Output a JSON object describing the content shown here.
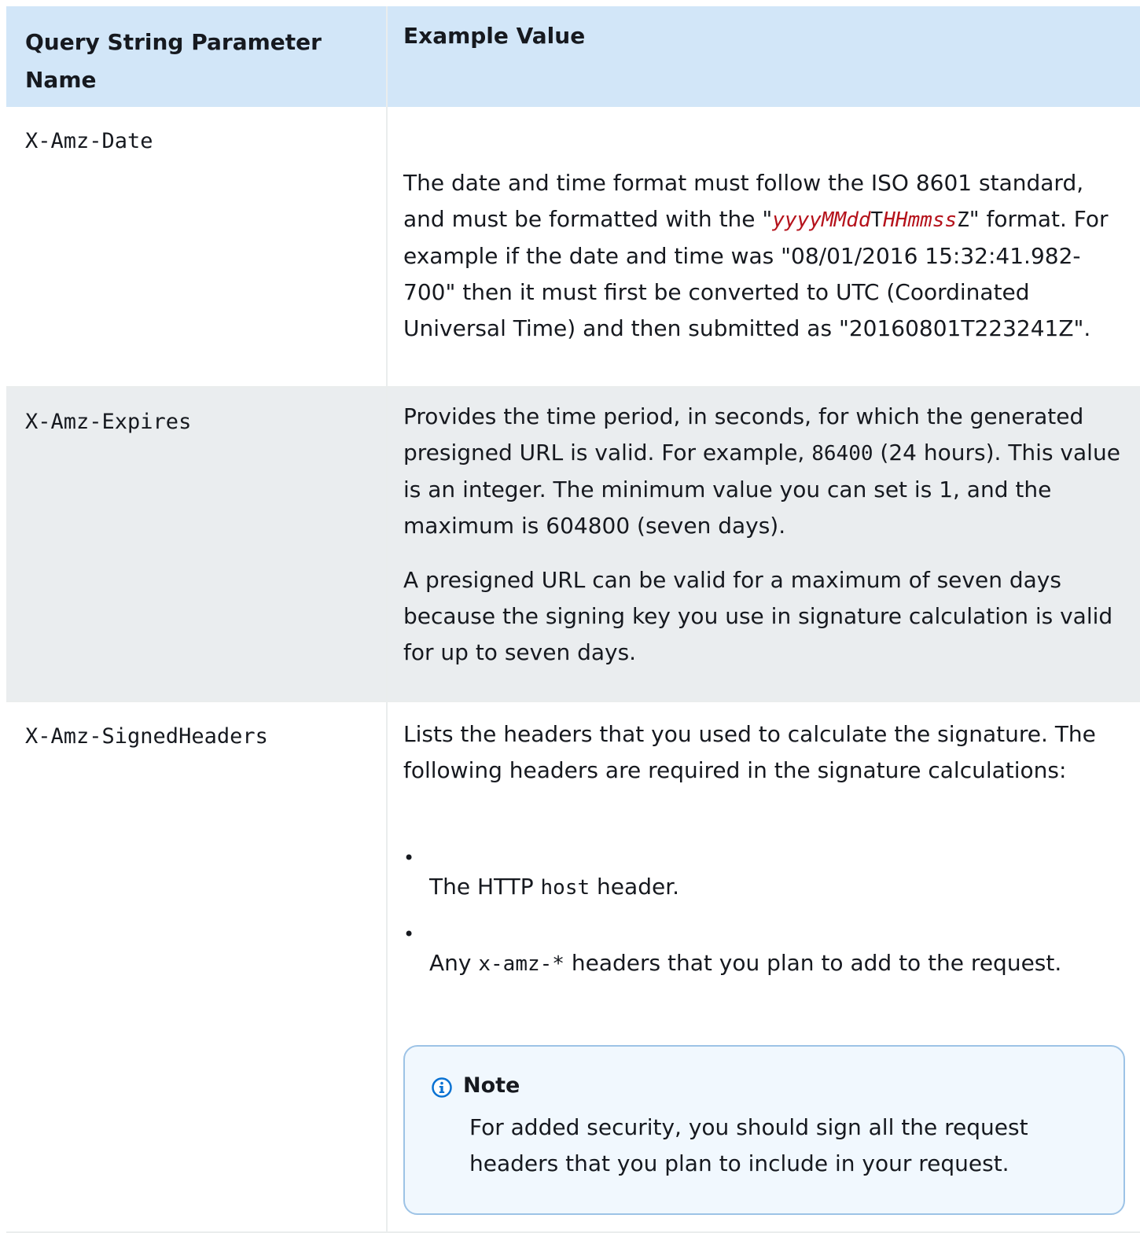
{
  "table": {
    "headers": {
      "param_name": "Query String Parameter Name",
      "example_value": "Example Value"
    },
    "rows": [
      {
        "name": "X-Amz-Date",
        "desc_a": "The date and time format must follow the ISO 8601 standard, and  must be formatted with the  \"",
        "fmt_1": "yyyyMMdd",
        "fmt_2": "T",
        "fmt_3": "HHmmss",
        "fmt_4": "Z",
        "desc_b": "\" format. For example if the date and time was \"08/01/2016 15:32:41.982-700\" then it must first be converted to UTC (Coordinated Universal Time) and then submitted as  \"20160801T223241Z\"."
      },
      {
        "name": "X-Amz-Expires",
        "p1_a": "Provides the time period, in seconds, for which the generated  presigned URL is valid. For example, ",
        "p1_code": "86400",
        "p1_b": " (24 hours).  This value is an integer. The minimum value you can set is 1, and  the maximum is 604800 (seven days).",
        "p2": "A presigned URL can be valid for a maximum of seven days because  the signing key you use in signature calculation is valid for up to  seven days."
      },
      {
        "name": "X-Amz-SignedHeaders",
        "intro": "Lists the headers that you used to calculate the signature. The following headers are  required in the signature calculations:",
        "bullet1_a": "The HTTP ",
        "bullet1_code": "host",
        "bullet1_b": " header.",
        "bullet2_a": "Any ",
        "bullet2_code": "x-amz-*",
        "bullet2_b": " headers that you plan to add  to the request.",
        "note_title": "Note",
        "note_body": "For added security, you should sign all the request headers that you plan to include in your request."
      }
    ]
  }
}
